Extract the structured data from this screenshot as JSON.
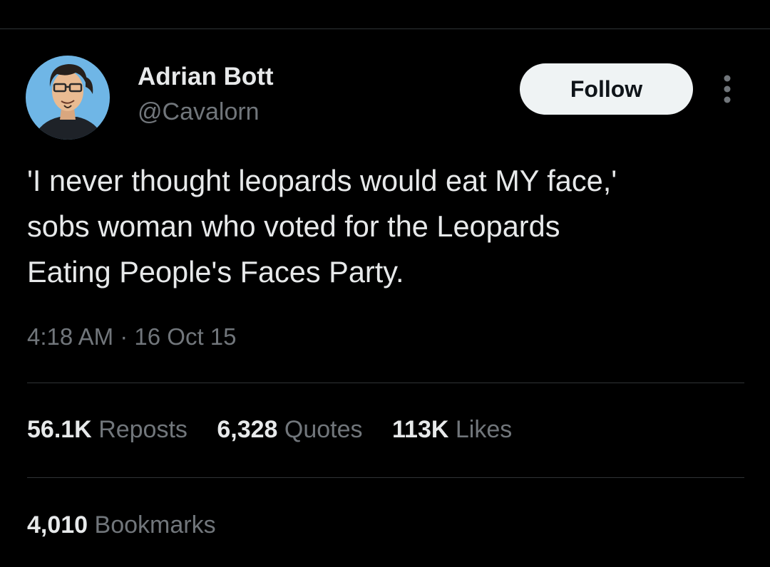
{
  "author": {
    "name": "Adrian Bott",
    "handle": "@Cavalorn",
    "avatar_icon": "cartoon-avatar"
  },
  "follow_button": {
    "label": "Follow"
  },
  "more_button": {
    "icon": "more-vertical-icon"
  },
  "tweet": {
    "lines": [
      "'I never thought leopards would eat MY face,'",
      "sobs woman who voted for the Leopards",
      "Eating People's Faces Party."
    ]
  },
  "timestamp": {
    "time": "4:18 AM",
    "separator": "·",
    "date": "16 Oct 15"
  },
  "stats": {
    "reposts": {
      "count": "56.1K",
      "label": "Reposts"
    },
    "quotes": {
      "count": "6,328",
      "label": "Quotes"
    },
    "likes": {
      "count": "113K",
      "label": "Likes"
    },
    "bookmarks": {
      "count": "4,010",
      "label": "Bookmarks"
    }
  },
  "colors": {
    "background": "#000000",
    "primary_text": "#e7e9ea",
    "secondary_text": "#71767b",
    "divider": "#2f3336",
    "follow_bg": "#eff3f4",
    "avatar_bg": "#6fb6e6"
  }
}
